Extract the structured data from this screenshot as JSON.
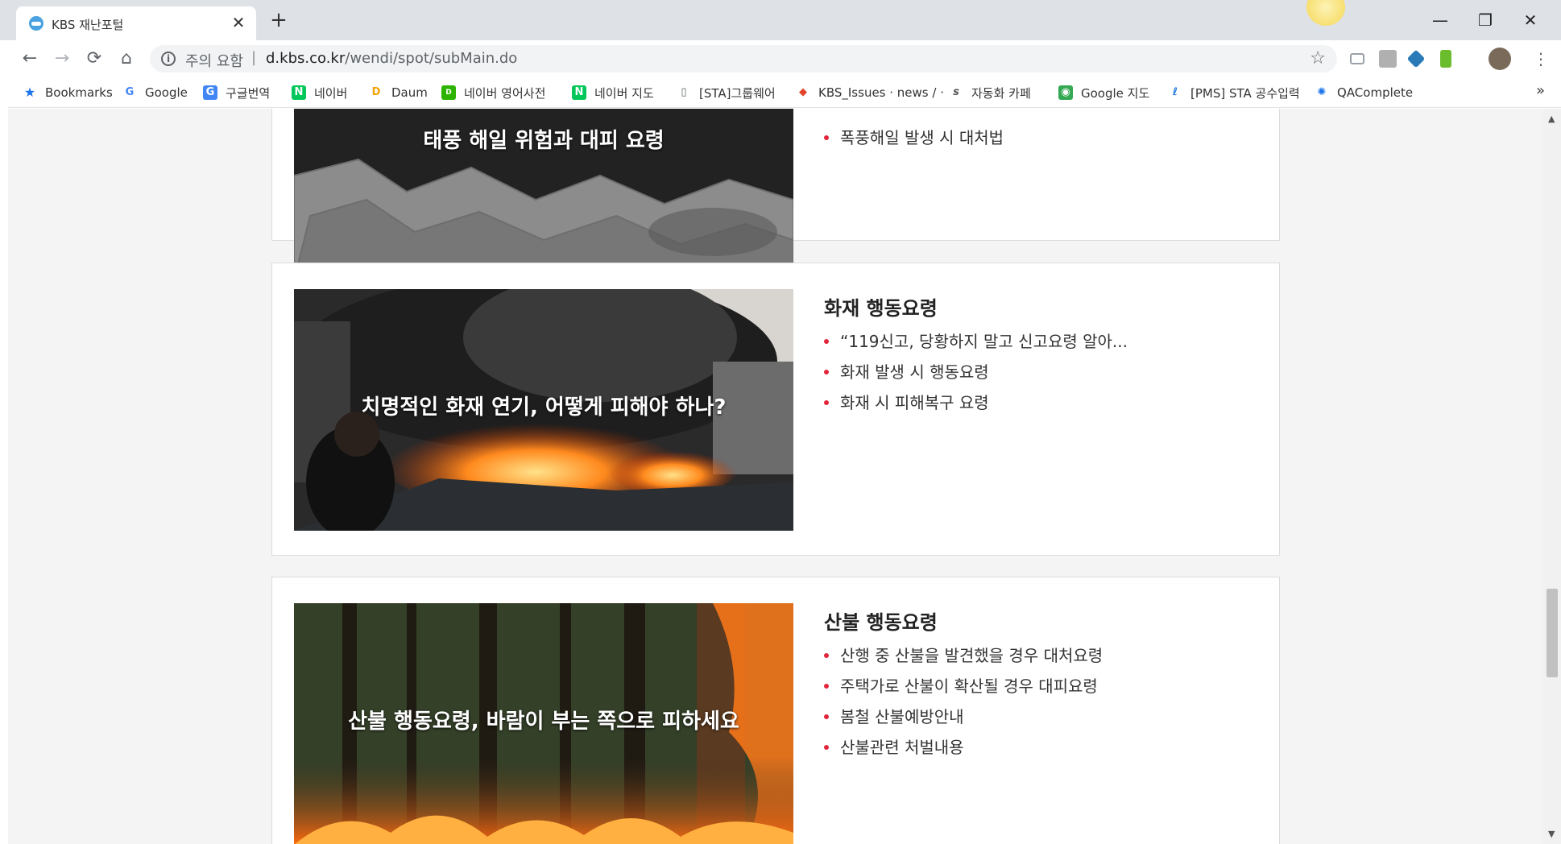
{
  "browser": {
    "tab_title": "KBS 재난포털",
    "tab_close": "✕",
    "new_tab": "+",
    "window_controls": {
      "minimize": "—",
      "restore": "❐",
      "close": "✕"
    },
    "nav": {
      "back": "←",
      "forward": "→",
      "reload": "⟳",
      "home": "⌂"
    },
    "omnibox": {
      "security_warning": "주의 요함",
      "separator": "|",
      "url_host": "d.kbs.co.kr",
      "url_path": "/wendi/spot/subMain.do",
      "info_icon": "i",
      "star_icon": "☆"
    },
    "bookmarks": [
      {
        "label": "Bookmarks",
        "icon": "star-icon",
        "color": "#1a73e8",
        "glyph": "★"
      },
      {
        "label": "Google",
        "icon": "google-icon",
        "color": "#ffffff",
        "glyph": "G"
      },
      {
        "label": "구글번역",
        "icon": "google-translate-icon",
        "color": "#4285f4",
        "glyph": "G"
      },
      {
        "label": "네이버",
        "icon": "naver-icon",
        "color": "#03c75a",
        "glyph": "N"
      },
      {
        "label": "Daum",
        "icon": "daum-icon",
        "color": "#ffffff",
        "glyph": "D"
      },
      {
        "label": "네이버 영어사전",
        "icon": "naver-dict-icon",
        "color": "#2db400",
        "glyph": "D"
      },
      {
        "label": "네이버 지도",
        "icon": "naver-map-icon",
        "color": "#03c75a",
        "glyph": "N"
      },
      {
        "label": "[STA]그룹웨어",
        "icon": "page-icon",
        "color": "#ffffff",
        "glyph": "▯"
      },
      {
        "label": "KBS_Issues · news / ·",
        "icon": "gitlab-icon",
        "color": "#e24329",
        "glyph": "◆"
      },
      {
        "label": "자동화 카페",
        "icon": "sta-icon",
        "color": "#ffffff",
        "glyph": "s"
      },
      {
        "label": "Google 지도",
        "icon": "google-maps-icon",
        "color": "#34a853",
        "glyph": "◉"
      },
      {
        "label": "[PMS] STA 공수입력",
        "icon": "pms-icon",
        "color": "#ffffff",
        "glyph": "ℓ"
      },
      {
        "label": "QAComplete",
        "icon": "qacomplete-icon",
        "color": "#ffffff",
        "glyph": "✺"
      }
    ],
    "bookmarks_more": "»"
  },
  "cards": [
    {
      "caption": "태풍 해일 위험과 대피 요령",
      "items": [
        "폭풍해일 발생 시 대처법"
      ]
    },
    {
      "heading": "화재 행동요령",
      "caption": "치명적인 화재 연기, 어떻게 피해야 하나?",
      "items": [
        "“119신고, 당황하지 말고 신고요령 알아...",
        "화재 발생 시 행동요령",
        "화재 시 피해복구 요령"
      ]
    },
    {
      "heading": "산불 행동요령",
      "caption": "산불 행동요령, 바람이 부는 쪽으로 피하세요",
      "items": [
        "산행 중 산불을 발견했을 경우 대처요령",
        "주택가로 산불이 확산될 경우 대피요령",
        "봄철 산불예방안내",
        "산불관련 처벌내용"
      ]
    }
  ],
  "colors": {
    "bullet": "#e1253a",
    "page_bg": "#f4f4f4",
    "card_border": "#dcdcdc"
  }
}
